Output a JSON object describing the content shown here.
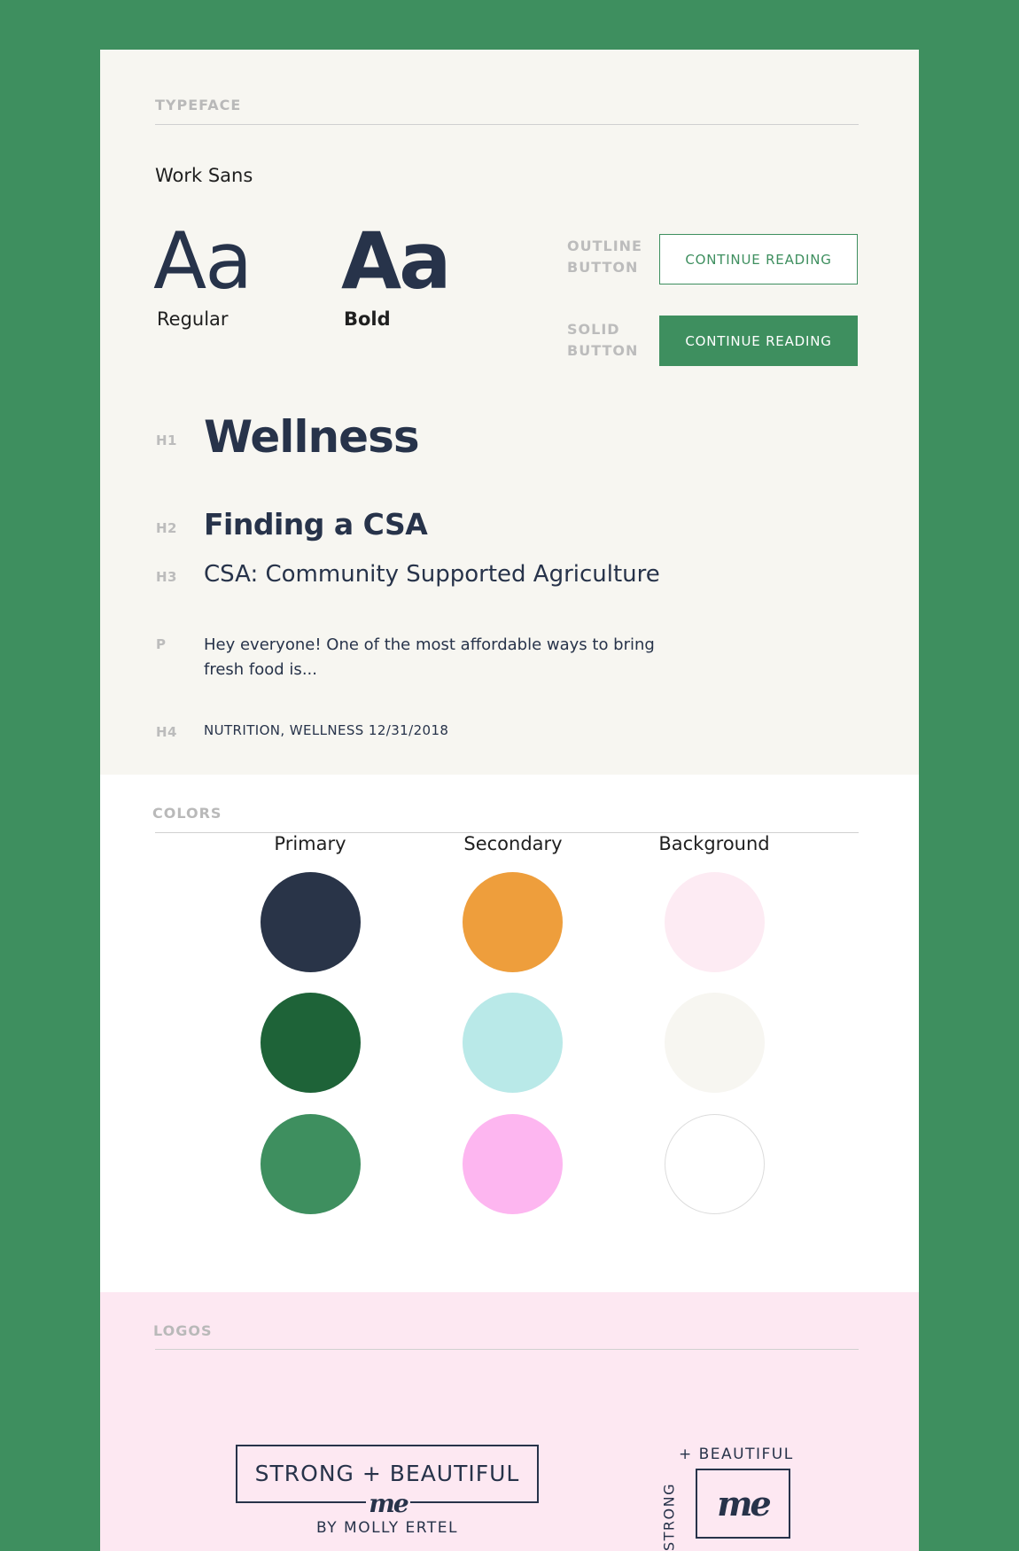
{
  "typeface": {
    "section_title": "TYPEFACE",
    "font_name": "Work Sans",
    "sample": "Aa",
    "regular_label": "Regular",
    "bold_label": "Bold",
    "outline_button_label": [
      "OUTLINE",
      "BUTTON"
    ],
    "solid_button_label": [
      "SOLID",
      "BUTTON"
    ],
    "button_text": "CONTINUE READING",
    "h1_tag": "H1",
    "h1_text": "Wellness",
    "h2_tag": "H2",
    "h2_text": "Finding a CSA",
    "h3_tag": "H3",
    "h3_text": "CSA: Community Supported Agriculture",
    "p_tag": "P",
    "p_text": "Hey everyone! One of the most affordable ways to bring fresh food is...",
    "h4_tag": "H4",
    "h4_text": "NUTRITION, WELLNESS 12/31/2018"
  },
  "colors": {
    "section_title": "COLORS",
    "columns": [
      {
        "name": "Primary",
        "swatches": [
          "#293448",
          "#1e6338",
          "#3e8f5f"
        ]
      },
      {
        "name": "Secondary",
        "swatches": [
          "#ee9e3c",
          "#b9e9e8",
          "#fdb6f0"
        ]
      },
      {
        "name": "Background",
        "swatches": [
          "#fdebf3",
          "#f7f6f1",
          "#ffffff"
        ]
      }
    ]
  },
  "logos": {
    "section_title": "LOGOS",
    "logo1_text": "STRONG + BEAUTIFUL",
    "logo1_script": "me",
    "logo1_byline": "BY MOLLY ERTEL",
    "logo2_top": "+ BEAUTIFUL",
    "logo2_side": "STRONG",
    "logo2_script": "me"
  },
  "theme": {
    "accent": "#3e8f5f",
    "navy": "#27334a"
  }
}
